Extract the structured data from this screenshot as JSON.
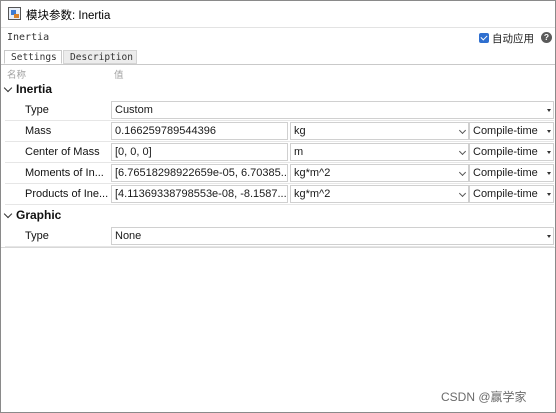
{
  "window": {
    "title": "模块参数: Inertia"
  },
  "header": {
    "block_name": "Inertia",
    "auto_apply_label": "自动应用",
    "help_icon": "question-mark-icon"
  },
  "tabs": [
    {
      "label": "Settings"
    },
    {
      "label": "Description"
    }
  ],
  "columns": {
    "name": "名称",
    "value": "值"
  },
  "groups": {
    "inertia": {
      "label": "Inertia",
      "rows": {
        "type": {
          "label": "Type",
          "value": "Custom"
        },
        "mass": {
          "label": "Mass",
          "value": "0.166259789544396",
          "unit": "kg",
          "mode": "Compile-time"
        },
        "com": {
          "label": "Center of Mass",
          "value": "[0, 0, 0]",
          "unit": "m",
          "mode": "Compile-time"
        },
        "moments": {
          "label": "Moments of In...",
          "value": "[6.76518298922659e-05, 6.70385...",
          "unit": "kg*m^2",
          "mode": "Compile-time"
        },
        "products": {
          "label": "Products of Ine...",
          "value": "[4.11369338798553e-08, -8.1587...",
          "unit": "kg*m^2",
          "mode": "Compile-time"
        }
      }
    },
    "graphic": {
      "label": "Graphic",
      "rows": {
        "type": {
          "label": "Type",
          "value": "None"
        }
      }
    }
  },
  "watermark": "CSDN @赢学家",
  "colors": {
    "accent": "#2f6fcf",
    "border": "#d0d0d0"
  }
}
